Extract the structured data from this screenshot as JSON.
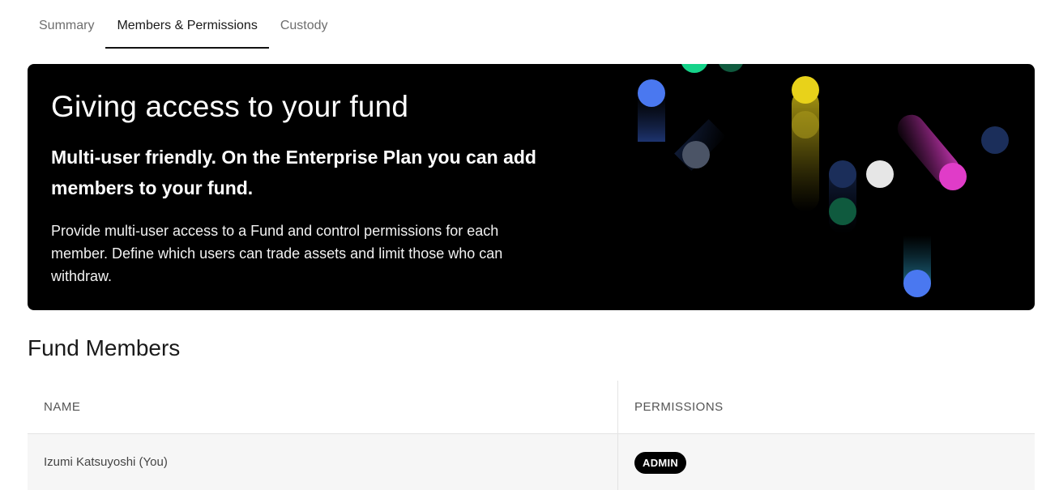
{
  "tabs": [
    {
      "label": "Summary",
      "active": false
    },
    {
      "label": "Members & Permissions",
      "active": true
    },
    {
      "label": "Custody",
      "active": false
    }
  ],
  "hero": {
    "title": "Giving access to your fund",
    "subtitle": "Multi-user friendly. On the Enterprise Plan you can add members to your fund.",
    "body": "Provide multi-user access to a Fund and control permissions for each member. Define which users can trade assets and limit those who can withdraw."
  },
  "members": {
    "title": "Fund Members",
    "columns": {
      "name": "NAME",
      "permissions": "PERMISSIONS"
    },
    "rows": [
      {
        "name": "Izumi Katsuyoshi (You)",
        "permission": "ADMIN"
      }
    ]
  },
  "colors": {
    "accent_blue": "#4a78f0",
    "accent_yellow": "#e8d21a",
    "accent_pink": "#e03cc8",
    "accent_green": "#16d38a"
  }
}
